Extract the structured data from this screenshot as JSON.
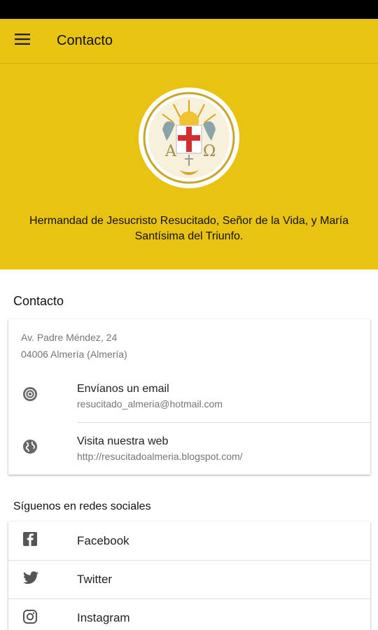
{
  "app_bar": {
    "title": "Contacto",
    "menu_icon": "hamburger-menu-icon"
  },
  "hero": {
    "logo_icon": "brotherhood-crest-logo",
    "name": "Hermandad de Jesucristo Resucitado, Señor de la Vida, y María Santísima del Triunfo."
  },
  "contact": {
    "title": "Contacto",
    "address_line1": "Av. Padre Méndez, 24",
    "address_line2": "04006 Almería (Almería)",
    "email": {
      "icon": "at-sign-icon",
      "label": "Envíanos un email",
      "value": "resucitado_almeria@hotmail.com"
    },
    "web": {
      "icon": "globe-icon",
      "label": "Visita nuestra web",
      "value": "http://resucitadoalmeria.blogspot.com/"
    }
  },
  "social": {
    "title": "Síguenos en redes sociales",
    "items": [
      {
        "icon": "facebook-icon",
        "label": "Facebook"
      },
      {
        "icon": "twitter-icon",
        "label": "Twitter"
      },
      {
        "icon": "instagram-icon",
        "label": "Instagram"
      }
    ]
  },
  "colors": {
    "primary": "#e8c312",
    "status_bar": "#000000",
    "cross_red": "#d32f2f"
  }
}
